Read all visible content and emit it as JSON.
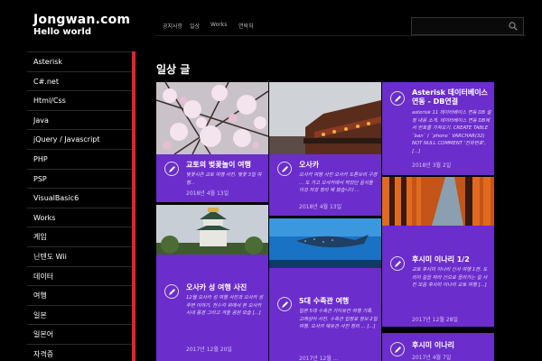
{
  "site": {
    "title": "Jongwan.com",
    "subtitle": "Hello world"
  },
  "sidebar": {
    "items": [
      {
        "label": "Asterisk"
      },
      {
        "label": "C#.net"
      },
      {
        "label": "Html/Css"
      },
      {
        "label": "Java"
      },
      {
        "label": "jQuery / Javascript"
      },
      {
        "label": "PHP"
      },
      {
        "label": "PSP"
      },
      {
        "label": "VisualBasic6"
      },
      {
        "label": "Works"
      },
      {
        "label": "게임"
      },
      {
        "label": "닌텐도 Wii"
      },
      {
        "label": "데이터"
      },
      {
        "label": "여행"
      },
      {
        "label": "일본"
      },
      {
        "label": "일본어"
      },
      {
        "label": "자격증"
      }
    ]
  },
  "nav": {
    "items": [
      {
        "label": "공지사항"
      },
      {
        "label": "일상"
      },
      {
        "label": "Works"
      },
      {
        "label": "연락처"
      }
    ]
  },
  "search": {
    "placeholder": ""
  },
  "page": {
    "title": "일상 글"
  },
  "cards": [
    {
      "title": "교토의 벚꽃놀이 여행",
      "excerpt": "벚꽃시즌 교토 여행 사진. 벚꽃 3일 여행...",
      "date": "2018년 4월 13일"
    },
    {
      "title": "오사카",
      "excerpt": "오사카 여행 사진 오사카 도톤보리 구경 ... 도 가고 오사카에서 먹었던 음식들 이것 저것 정리 해 봤습니다 ...",
      "date": "2018년 4월 13일"
    },
    {
      "title": "Asterisk 데이터베이스 연동 - DB연결",
      "excerpt": "asterisk 11 데이터베이스 연동 DB 설정 내용 소개. 데이터베이스 연동 DB에서 번호를 가져오기. CREATE TABLE `ban` ( `phone` VARCHAR(32) NOT NULL COMMENT '전화번호', [...]",
      "date": "2018년 3월 2일"
    },
    {
      "title": "오사카 성 여행 사진",
      "excerpt": "12월 오사카 성 여행 사진과 오사카 성 주변 이야기. 천수각 위에서 본 오사카 시내 풍경 그리고 겨울 공원 모습 [...]",
      "date": "2017년 12월 20일"
    },
    {
      "title": "5대 수족관 여행",
      "excerpt": "일본 5대 수족관 가이유칸 여행 기록. 고래상어 사진. 수족관 입장료 정보 2일 여행. 오사카 해유관 사진 정리 ... [...]",
      "date": "2017년 12월 ..."
    },
    {
      "title": "후시미 이나리 1/2",
      "excerpt": "교토 후시미 이나리 신사 여행 1편. 도리이 길을 따라 산으로 올라가는 길 사진 모음 후시미 이나리 교토 여행 [...]",
      "date": "2017년 12월 28일"
    },
    {
      "title": "후시미 이나리",
      "excerpt": "",
      "date": "2017년 4월 7일"
    }
  ]
}
